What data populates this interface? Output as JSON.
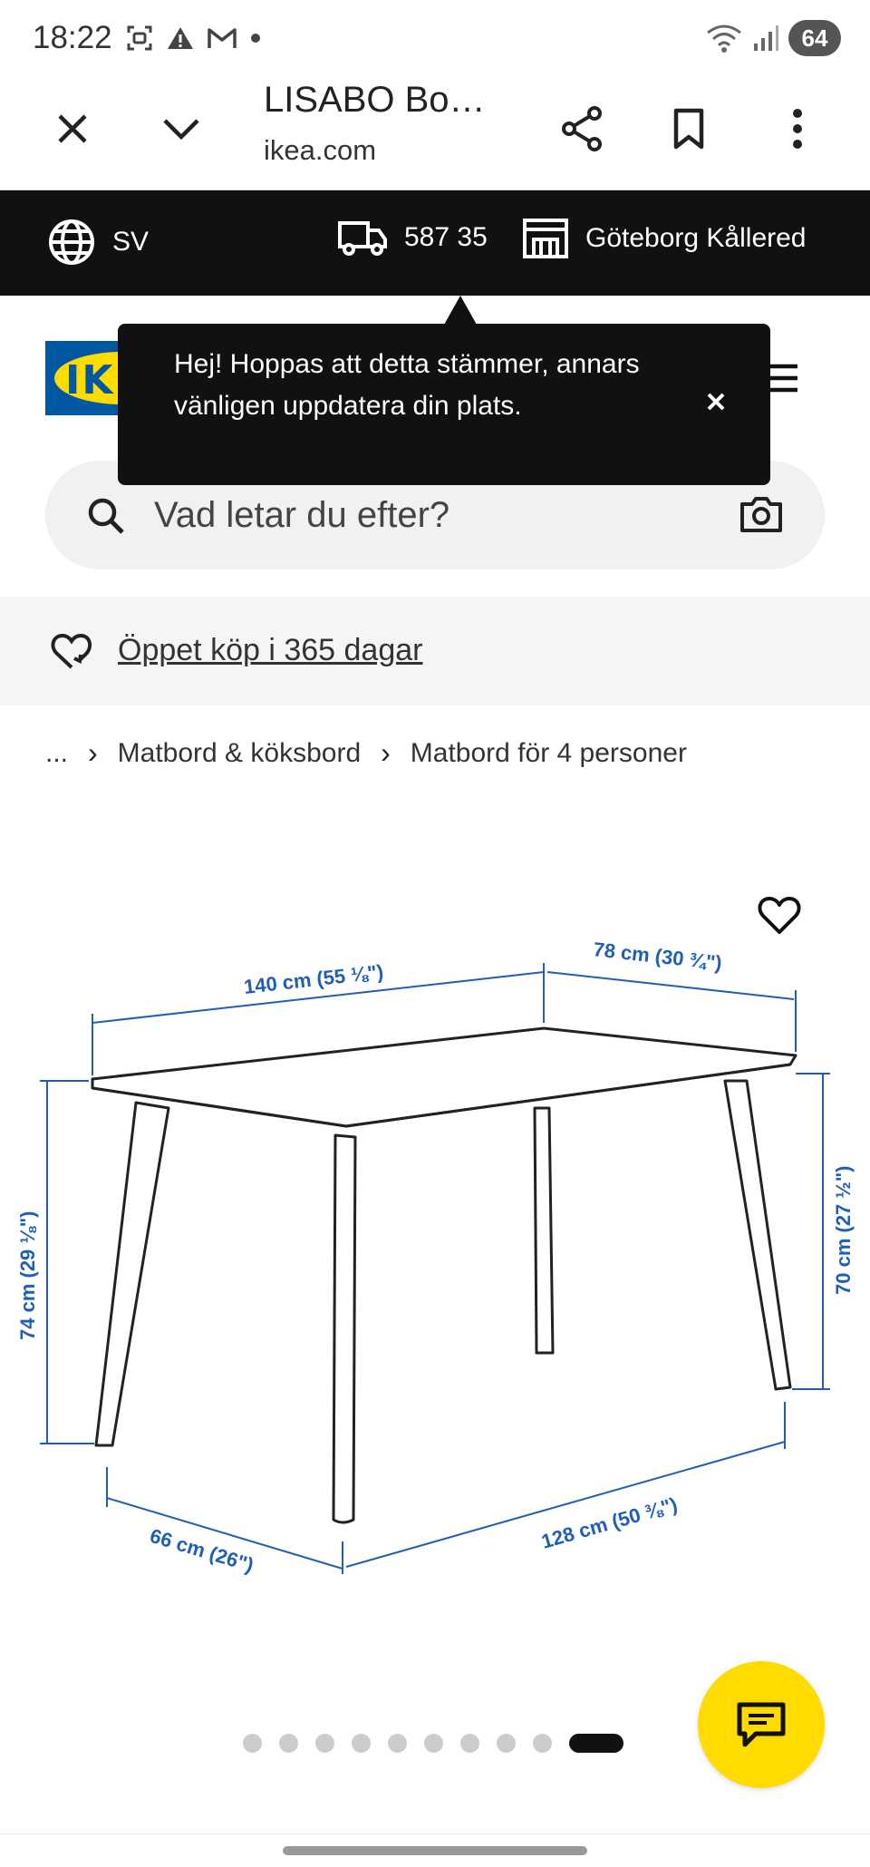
{
  "status_bar": {
    "time": "18:22",
    "battery": "64",
    "left_icons": [
      "screenshot-icon",
      "warning-icon",
      "gmail-icon",
      "dot-icon"
    ],
    "right_icons": [
      "wifi-icon",
      "signal-icon"
    ]
  },
  "browser": {
    "title": "LISABO Bo…",
    "domain": "ikea.com",
    "icons": [
      "close-icon",
      "chevron-down-icon",
      "share-icon",
      "bookmark-icon",
      "more-vert-icon"
    ]
  },
  "topbar": {
    "language": "SV",
    "postal_code": "587 35",
    "store": "Göteborg Kållered"
  },
  "tooltip": {
    "message": "Hej! Hoppas att detta stämmer, annars vänligen uppdatera din plats."
  },
  "logo": {
    "text": "IKEA"
  },
  "search": {
    "placeholder": "Vad letar du efter?"
  },
  "returns": {
    "label": "Öppet köp i 365 dagar"
  },
  "breadcrumb": {
    "ellipsis": "...",
    "items": [
      "Matbord & köksbord",
      "Matbord för 4 personer"
    ]
  },
  "dimensions": {
    "length_top": "140 cm (55 ⅛\")",
    "width_top": "78 cm (30 ¾\")",
    "height_total": "74 cm (29 ⅛\")",
    "height_under": "70 cm (27 ½\")",
    "width_legs": "66 cm (26\")",
    "length_legs": "128 cm (50 ⅜\")"
  },
  "carousel": {
    "count": 10,
    "active_index": 9
  },
  "colors": {
    "ikea_blue": "#0058a3",
    "ikea_yellow": "#ffdb00",
    "dimension_blue": "#1f5fb6",
    "dark_bar": "#111111"
  }
}
